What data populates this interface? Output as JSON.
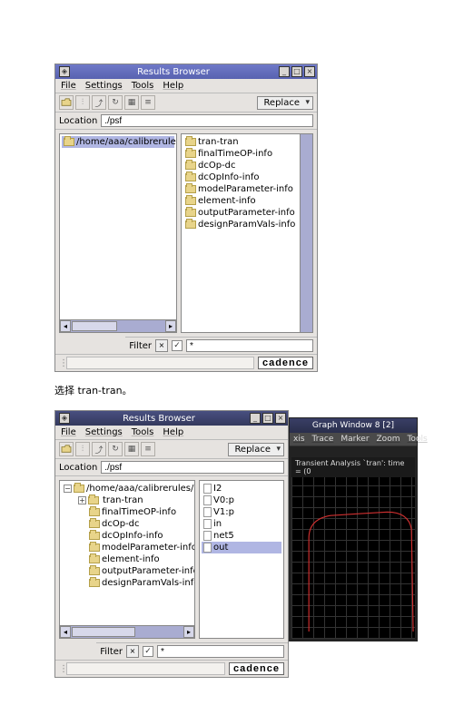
{
  "win1": {
    "title": "Results Browser",
    "menus": [
      "File",
      "Settings",
      "Tools",
      "Help"
    ],
    "combo": "Replace",
    "location_label": "Location",
    "location_value": "./psf",
    "left_path": "/home/aaa/calibrerules/invpe",
    "right_items": [
      "tran-tran",
      "finalTimeOP-info",
      "dcOp-dc",
      "dcOpInfo-info",
      "modelParameter-info",
      "element-info",
      "outputParameter-info",
      "designParamVals-info"
    ],
    "filter_label": "Filter",
    "filter_value": "*",
    "brand": "cadence"
  },
  "caption": "选择 tran-tran。",
  "win2": {
    "title": "Results Browser",
    "menus": [
      "File",
      "Settings",
      "Tools",
      "Help"
    ],
    "combo": "Replace",
    "location_label": "Location",
    "location_value": "./psf",
    "left_root": "/home/aaa/calibrerules/invpe",
    "left_items": [
      {
        "label": "tran-tran",
        "selected": true
      },
      {
        "label": "finalTimeOP-info"
      },
      {
        "label": "dcOp-dc"
      },
      {
        "label": "dcOpInfo-info"
      },
      {
        "label": "modelParameter-info"
      },
      {
        "label": "element-info"
      },
      {
        "label": "outputParameter-info"
      },
      {
        "label": "designParamVals-info"
      }
    ],
    "right_items": [
      {
        "label": "I2"
      },
      {
        "label": "V0:p"
      },
      {
        "label": "V1:p"
      },
      {
        "label": "in"
      },
      {
        "label": "net5"
      },
      {
        "label": "out",
        "selected": true
      }
    ],
    "filter_label": "Filter",
    "filter_value": "*",
    "brand": "cadence"
  },
  "graph": {
    "title": "Graph Window 8 [2]",
    "menus": [
      "xis",
      "Trace",
      "Marker",
      "Zoom",
      "Tools"
    ],
    "subtitle": "Transient Analysis `tran': time = (0 "
  }
}
